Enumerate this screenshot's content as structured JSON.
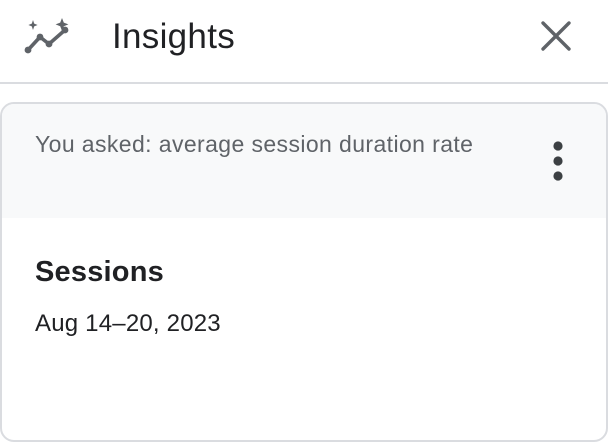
{
  "header": {
    "icon": "insights-sparkle-icon",
    "title": "Insights",
    "close_icon": "close-icon"
  },
  "card": {
    "question": "You asked: average session duration rate",
    "more_icon": "more-vert-icon",
    "metric": "Sessions",
    "date_range": "Aug 14–20, 2023"
  },
  "colors": {
    "divider": "#dadce0",
    "card_header_bg": "#f8f9fa",
    "text_primary": "#202124",
    "text_secondary": "#5f6368"
  }
}
